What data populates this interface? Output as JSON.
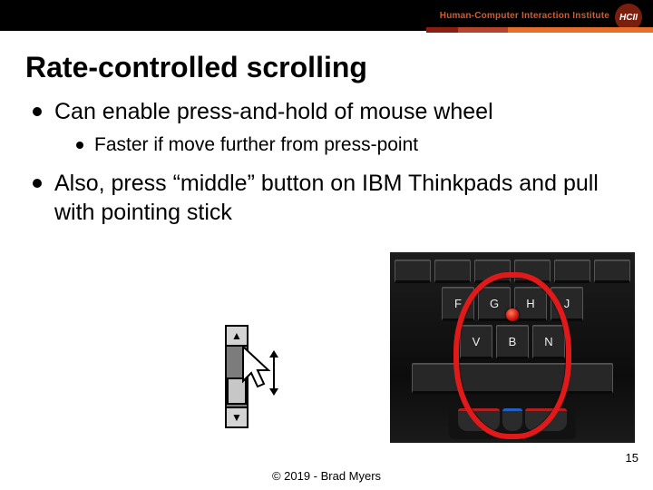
{
  "brand": {
    "text": "Human-Computer Interaction Institute",
    "badge": "HCII"
  },
  "title": "Rate-controlled scrolling",
  "bullets": {
    "b0": "Can enable press-and-hold of mouse wheel",
    "b0s0": "Faster if move further from press-point",
    "b1": "Also, press “middle” button on IBM Thinkpads and pull with pointing stick"
  },
  "keys": {
    "t0": "F",
    "t1": "G",
    "t2": "H",
    "t3": "J",
    "m0": "V",
    "m1": "B",
    "m2": "N"
  },
  "slide_number": "15",
  "copyright": "© 2019 - Brad Myers"
}
